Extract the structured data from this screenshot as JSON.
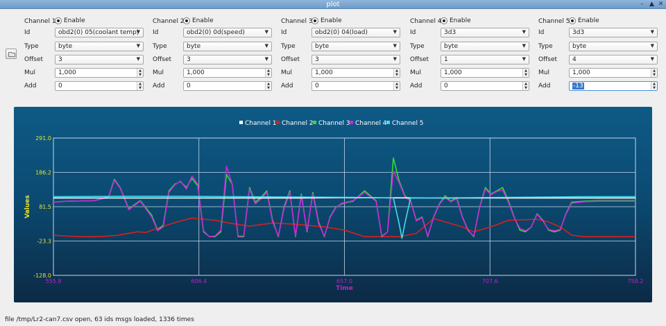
{
  "window": {
    "title": "plot"
  },
  "side_button": {
    "icon": "folder-open-icon"
  },
  "labels": {
    "id": "Id",
    "type": "Type",
    "offset": "Offset",
    "mul": "Mul",
    "add": "Add",
    "enable": "Enable"
  },
  "channels": [
    {
      "name": "Channel 1",
      "id": "obd2(0) 05(coolant temp)",
      "type": "byte",
      "offset": "3",
      "mul": "1,000",
      "add": "0",
      "color": "#ffffff"
    },
    {
      "name": "Channel 2",
      "id": "obd2(0) 0d(speed)",
      "type": "byte",
      "offset": "3",
      "mul": "1,000",
      "add": "0",
      "color": "#d8201c"
    },
    {
      "name": "Channel 3",
      "id": "obd2(0) 04(load)",
      "type": "byte",
      "offset": "3",
      "mul": "1,000",
      "add": "0",
      "color": "#33dd33"
    },
    {
      "name": "Channel 4",
      "id": "3d3",
      "type": "byte",
      "offset": "1",
      "mul": "1,000",
      "add": "0",
      "color": "#cc22dd"
    },
    {
      "name": "Channel 5",
      "id": "3d3",
      "type": "byte",
      "offset": "4",
      "mul": "1,000",
      "add": "-13",
      "color": "#44ddee"
    }
  ],
  "chart_data": {
    "type": "line",
    "xlabel": "Time",
    "ylabel": "Values",
    "xlim": [
      555.8,
      758.2
    ],
    "ylim": [
      -128.0,
      291.0
    ],
    "xticks": [
      "555.8",
      "606.4",
      "657.0",
      "707.6",
      "758.2"
    ],
    "yticks": [
      "291.0",
      "186.2",
      "81.5",
      "-23.3",
      "-128.0"
    ],
    "grid": true,
    "legend_position": "top-center",
    "series": [
      {
        "name": "Channel 1",
        "color": "#ffffff",
        "x": [
          555.8,
          600,
          640,
          657,
          700,
          740,
          758.2
        ],
        "y": [
          108,
          108,
          108,
          109,
          108,
          108,
          108
        ]
      },
      {
        "name": "Channel 2",
        "color": "#d8201c",
        "x": [
          555.8,
          558,
          565,
          572,
          578,
          585,
          588,
          594,
          600,
          604,
          612,
          618,
          624,
          632,
          640,
          650,
          657,
          664,
          670,
          676,
          682,
          688,
          692,
          698,
          702,
          708,
          714,
          720,
          724,
          728,
          732,
          736,
          740,
          744,
          750,
          758.2
        ],
        "y": [
          -5,
          -7,
          -10,
          -10,
          -6,
          5,
          3,
          22,
          38,
          47,
          40,
          30,
          22,
          32,
          28,
          20,
          10,
          -10,
          -10,
          -10,
          0,
          45,
          35,
          20,
          5,
          20,
          40,
          42,
          43,
          35,
          20,
          -5,
          -10,
          -10,
          -10,
          -10
        ]
      },
      {
        "name": "Channel 3",
        "color": "#33dd33",
        "x": [
          555.8,
          560,
          570,
          575,
          577,
          579,
          582,
          586,
          590,
          592,
          594,
          596,
          598,
          600,
          602,
          604,
          606,
          608,
          610,
          612,
          614,
          616,
          618,
          620,
          622,
          624,
          626,
          628,
          630,
          632,
          634,
          636,
          638,
          640,
          642,
          644,
          646,
          648,
          650,
          652,
          654,
          656,
          658,
          660,
          664,
          668,
          670,
          672,
          674,
          676,
          678,
          680,
          682,
          684,
          686,
          688,
          690,
          692,
          694,
          696,
          698,
          700,
          702,
          704,
          706,
          708,
          710,
          712,
          714,
          716,
          718,
          720,
          722,
          724,
          726,
          728,
          730,
          732,
          734,
          736,
          740,
          745,
          750,
          758.2
        ],
        "y": [
          95,
          98,
          100,
          112,
          165,
          140,
          75,
          100,
          55,
          10,
          25,
          130,
          150,
          158,
          140,
          168,
          145,
          5,
          -10,
          -10,
          5,
          180,
          150,
          -10,
          -10,
          140,
          95,
          110,
          130,
          40,
          -10,
          80,
          130,
          -10,
          120,
          5,
          125,
          35,
          -10,
          50,
          80,
          90,
          95,
          98,
          130,
          100,
          -10,
          5,
          230,
          160,
          115,
          100,
          40,
          50,
          -10,
          50,
          90,
          115,
          98,
          110,
          50,
          10,
          -10,
          80,
          140,
          120,
          130,
          140,
          100,
          50,
          10,
          5,
          20,
          60,
          40,
          10,
          5,
          10,
          60,
          95,
          98,
          100,
          100,
          100
        ]
      },
      {
        "name": "Channel 4",
        "color": "#cc22dd",
        "x": [
          555.8,
          560,
          570,
          575,
          577,
          579,
          582,
          586,
          590,
          592,
          594,
          596,
          598,
          600,
          602,
          604,
          606,
          608,
          610,
          612,
          614,
          616,
          618,
          620,
          622,
          624,
          626,
          628,
          630,
          632,
          634,
          636,
          638,
          640,
          642,
          644,
          646,
          648,
          650,
          652,
          654,
          656,
          658,
          660,
          664,
          668,
          670,
          672,
          674,
          676,
          678,
          680,
          682,
          684,
          686,
          688,
          690,
          692,
          694,
          696,
          698,
          700,
          702,
          704,
          706,
          708,
          710,
          712,
          714,
          716,
          718,
          720,
          722,
          724,
          726,
          728,
          730,
          732,
          734,
          736,
          740,
          745,
          750,
          758.2
        ],
        "y": [
          95,
          98,
          100,
          110,
          162,
          138,
          72,
          98,
          50,
          8,
          20,
          125,
          148,
          160,
          135,
          175,
          150,
          8,
          -10,
          -8,
          10,
          205,
          150,
          -8,
          -8,
          135,
          90,
          105,
          125,
          35,
          -8,
          75,
          125,
          -8,
          115,
          8,
          120,
          30,
          -8,
          48,
          78,
          92,
          96,
          100,
          125,
          98,
          -8,
          5,
          190,
          155,
          112,
          98,
          38,
          48,
          -8,
          48,
          88,
          110,
          96,
          106,
          48,
          8,
          -8,
          78,
          135,
          118,
          128,
          132,
          95,
          48,
          15,
          8,
          20,
          58,
          38,
          12,
          8,
          12,
          58,
          92,
          96,
          98,
          98,
          98
        ]
      },
      {
        "name": "Channel 5",
        "color": "#44ddee",
        "x": [
          555.8,
          580,
          600,
          640,
          660,
          674,
          676,
          677,
          678,
          680,
          700,
          740,
          758.2
        ],
        "y": [
          112,
          113,
          113,
          111,
          110,
          108,
          30,
          -15,
          30,
          108,
          109,
          112,
          112
        ]
      }
    ]
  },
  "status": {
    "text": "file /tmp/Lr2-can7.csv open, 63 ids msgs loaded, 1336 times"
  }
}
